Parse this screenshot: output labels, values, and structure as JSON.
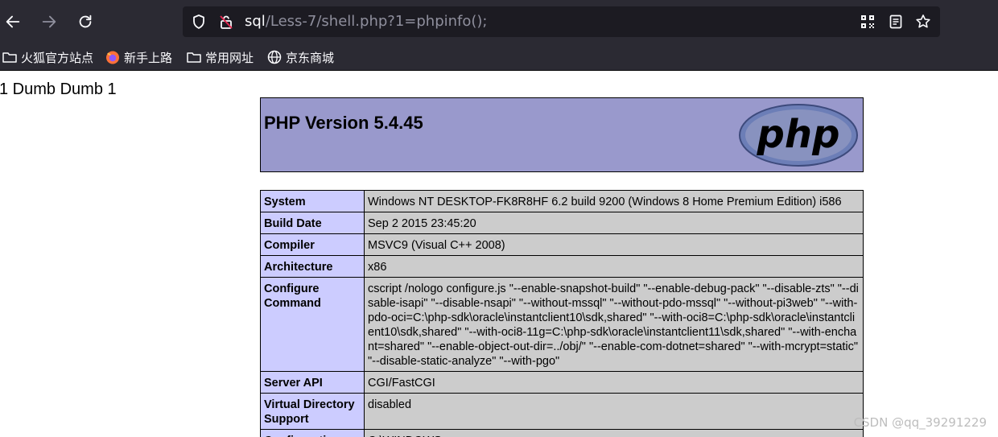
{
  "browser": {
    "url_host": "sql",
    "url_path": "/Less-7/shell.php?1=phpinfo();",
    "bookmarks": [
      {
        "label": "火狐官方站点",
        "icon": "folder-icon"
      },
      {
        "label": "新手上路",
        "icon": "firefox-icon"
      },
      {
        "label": "常用网址",
        "icon": "folder-icon"
      },
      {
        "label": "京东商城",
        "icon": "globe-icon"
      }
    ]
  },
  "page": {
    "sqli_output": "1 Dumb Dumb 1",
    "phpinfo_title": "PHP Version 5.4.45",
    "logo_text": "php",
    "rows": [
      {
        "key": "System",
        "value": "Windows NT DESKTOP-FK8R8HF 6.2 build 9200 (Windows 8 Home Premium Edition) i586"
      },
      {
        "key": "Build Date",
        "value": "Sep 2 2015 23:45:20"
      },
      {
        "key": "Compiler",
        "value": "MSVC9 (Visual C++ 2008)"
      },
      {
        "key": "Architecture",
        "value": "x86"
      },
      {
        "key": "Configure Command",
        "value": "cscript /nologo configure.js \"--enable-snapshot-build\" \"--enable-debug-pack\" \"--disable-zts\" \"--disable-isapi\" \"--disable-nsapi\" \"--without-mssql\" \"--without-pdo-mssql\" \"--without-pi3web\" \"--with-pdo-oci=C:\\php-sdk\\oracle\\instantclient10\\sdk,shared\" \"--with-oci8=C:\\php-sdk\\oracle\\instantclient10\\sdk,shared\" \"--with-oci8-11g=C:\\php-sdk\\oracle\\instantclient11\\sdk,shared\" \"--with-enchant=shared\" \"--enable-object-out-dir=../obj/\" \"--enable-com-dotnet=shared\" \"--with-mcrypt=static\" \"--disable-static-analyze\" \"--with-pgo\""
      },
      {
        "key": "Server API",
        "value": "CGI/FastCGI"
      },
      {
        "key": "Virtual Directory Support",
        "value": "disabled"
      },
      {
        "key": "Configuration",
        "value": "C:\\WINDOWS"
      }
    ]
  },
  "watermark": "CSDN @qq_39291229"
}
